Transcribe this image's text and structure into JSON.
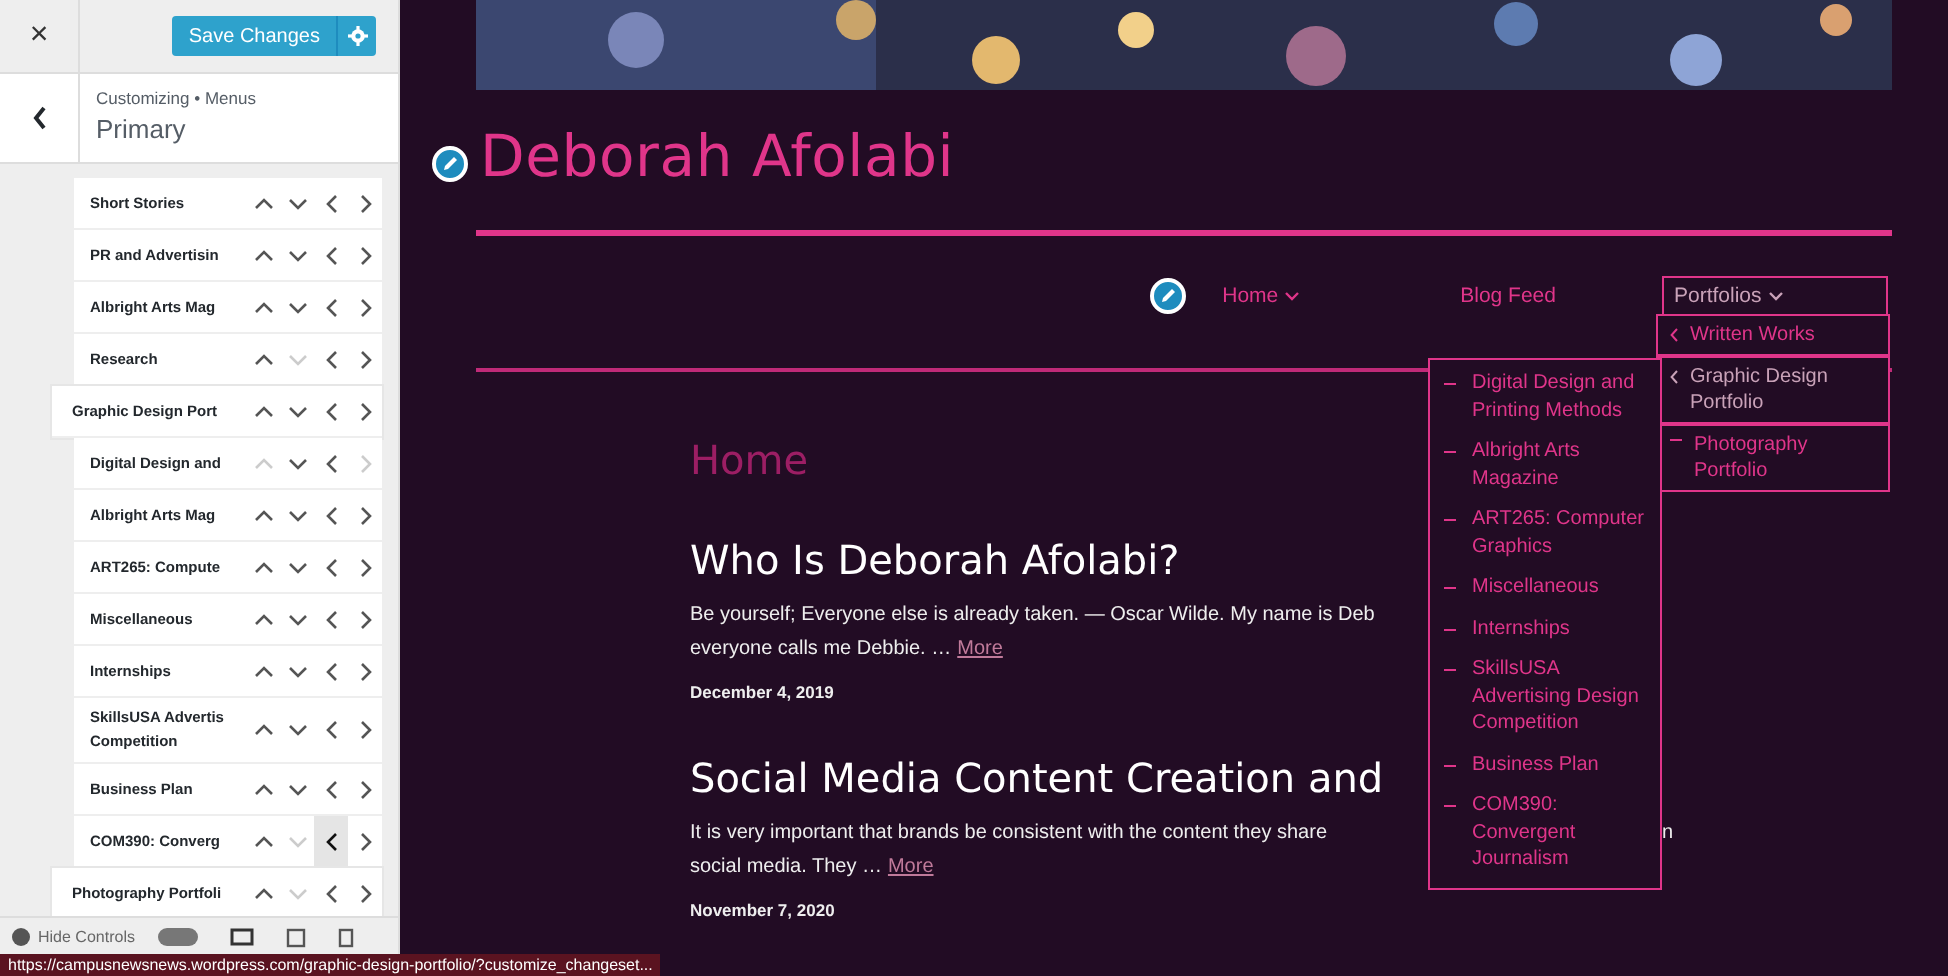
{
  "sidebar": {
    "close": "×",
    "save_button": "Save Changes",
    "breadcrumb": "Customizing • Menus",
    "section_title": "Primary",
    "menu_items": [
      {
        "children": [
          {
            "label": "Short Stories",
            "arrows": {
              "up": true,
              "down": true,
              "left": true,
              "right": true
            }
          },
          {
            "label": "PR and Advertisin",
            "arrows": {
              "up": true,
              "down": true,
              "left": true,
              "right": true
            }
          },
          {
            "label": "Albright Arts Mag",
            "arrows": {
              "up": true,
              "down": true,
              "left": true,
              "right": true
            }
          },
          {
            "label": "Research",
            "arrows": {
              "up": true,
              "down": false,
              "left": true,
              "right": true
            }
          }
        ]
      },
      {
        "label": "Graphic Design Port",
        "arrows": {
          "up": true,
          "down": true,
          "left": true,
          "right": true
        },
        "children": [
          {
            "label": "Digital Design and",
            "arrows": {
              "up": false,
              "down": true,
              "left": true,
              "right": false
            }
          },
          {
            "label": "Albright Arts Mag",
            "arrows": {
              "up": true,
              "down": true,
              "left": true,
              "right": true
            }
          },
          {
            "label": "ART265: Compute",
            "arrows": {
              "up": true,
              "down": true,
              "left": true,
              "right": true
            }
          },
          {
            "label": "Miscellaneous",
            "arrows": {
              "up": true,
              "down": true,
              "left": true,
              "right": true
            }
          },
          {
            "label": "Internships",
            "arrows": {
              "up": true,
              "down": true,
              "left": true,
              "right": true
            }
          },
          {
            "label": "SkillsUSA Advertis\nCompetition",
            "arrows": {
              "up": true,
              "down": true,
              "left": true,
              "right": true
            }
          },
          {
            "label": "Business Plan",
            "arrows": {
              "up": true,
              "down": true,
              "left": true,
              "right": true
            }
          },
          {
            "label": "COM390: Converg",
            "arrows": {
              "up": true,
              "down": false,
              "left": true,
              "right": true
            },
            "hovered": {
              "up": false,
              "down": false,
              "left": true,
              "right": false
            }
          }
        ]
      },
      {
        "label": "Photography Portfoli",
        "arrows": {
          "up": true,
          "down": false,
          "left": true,
          "right": true
        }
      }
    ],
    "footer": {
      "label": "Hide Controls",
      "toggle_on": false
    }
  },
  "status_url": "https://campusnewsnews.wordpress.com/graphic-design-portfolio/?customize_changeset...",
  "site": {
    "title": "Deborah Afolabi",
    "nav": [
      {
        "label": "Home",
        "has_submenu": true,
        "selected": false
      },
      {
        "label": "Blog Feed",
        "has_submenu": false,
        "selected": false
      },
      {
        "label": "Portfolios",
        "has_submenu": true,
        "selected": true
      }
    ],
    "dropdown": [
      {
        "label": "Written Works",
        "selected": false
      },
      {
        "label": "Graphic Design Portfolio",
        "selected": true
      },
      {
        "label": "Photography Portfolio",
        "selected": false
      }
    ],
    "subdropdown": [
      "Digital Design and Printing Methods",
      "Albright Arts Magazine",
      "ART265: Computer Graphics",
      "Miscellaneous",
      "Internships",
      "SkillsUSA Advertising Design Competition",
      "Business Plan",
      "COM390: Convergent Journalism"
    ],
    "page_heading": "Home",
    "posts": [
      {
        "title": "Who Is Deborah Afolabi?",
        "excerpt_line": "Be yourself; Everyone else is already taken. — Oscar Wilde. My name is Deb",
        "excerpt_rest": "everyone calls me Debbie. …",
        "more": "More",
        "date": "December 4, 2019"
      },
      {
        "title": "Social Media Content Creation and",
        "excerpt_line": "It is very important that brands be consistent with the content they share",
        "excerpt_tail": "n",
        "excerpt_rest": "social media. They …",
        "more": "More",
        "date": "November 7, 2020"
      }
    ]
  }
}
